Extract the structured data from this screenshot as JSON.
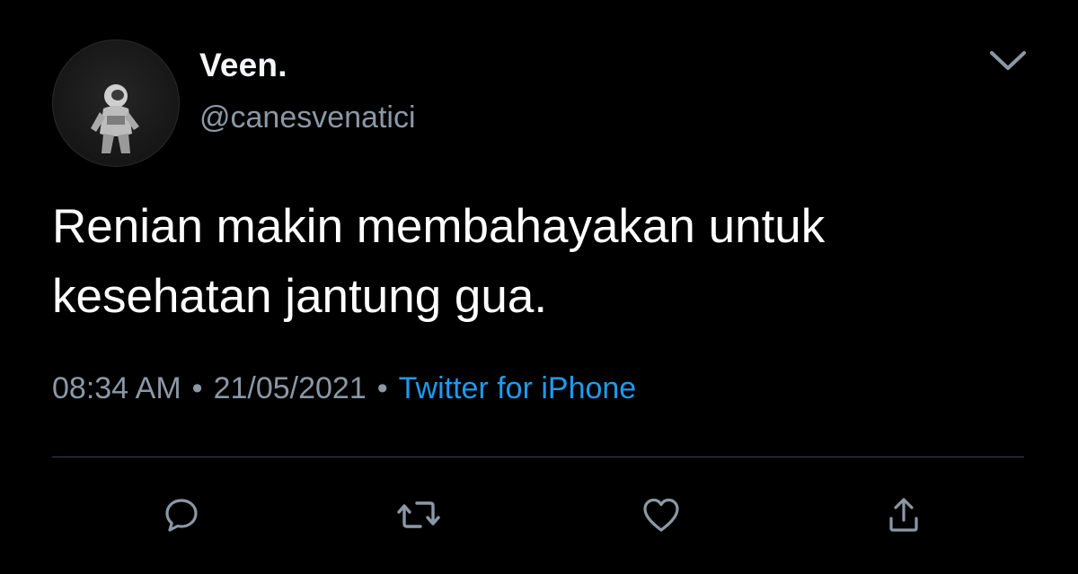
{
  "author": {
    "display_name": "Veen.",
    "handle": "@canesvenatici",
    "avatar_icon": "astronaut-avatar"
  },
  "tweet": {
    "text": "Renian makin membahayakan untuk\nkesehatan jantung gua."
  },
  "meta": {
    "time": "08:34 AM",
    "date": "21/05/2021",
    "separator": "•",
    "source": "Twitter for iPhone"
  },
  "actions": {
    "icons": [
      "reply-icon",
      "retweet-icon",
      "like-icon",
      "share-icon"
    ]
  },
  "colors": {
    "background": "#000000",
    "text_primary": "#ffffff",
    "text_secondary": "#8b98a5",
    "accent": "#1d9bf0",
    "divider": "#38444d"
  }
}
